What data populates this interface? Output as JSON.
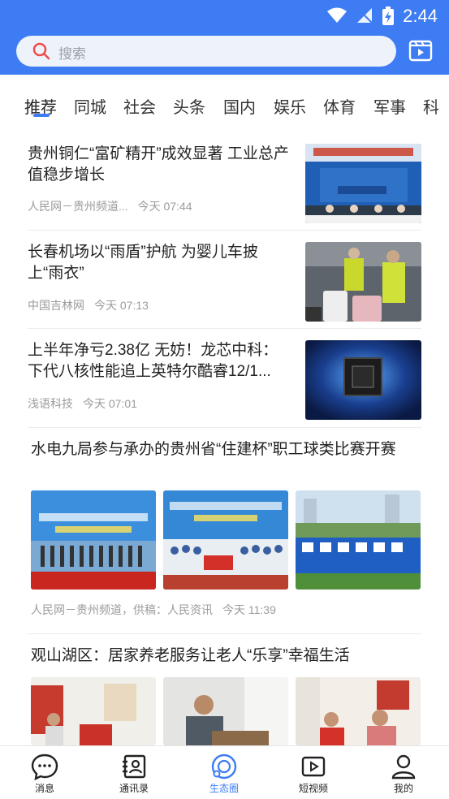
{
  "status_bar": {
    "time": "2:44"
  },
  "search": {
    "placeholder": "搜索"
  },
  "tabs": [
    {
      "label": "推荐"
    },
    {
      "label": "同城"
    },
    {
      "label": "社会"
    },
    {
      "label": "头条"
    },
    {
      "label": "国内"
    },
    {
      "label": "娱乐"
    },
    {
      "label": "体育"
    },
    {
      "label": "军事"
    },
    {
      "label": "科"
    }
  ],
  "articles": [
    {
      "title": "贵州铜仁“富矿精开”成效显著 工业总产值稳步增长",
      "source": "人民网－贵州频道...",
      "time": "今天 07:44"
    },
    {
      "title": "长春机场以“雨盾”护航 为婴儿车披上“雨衣”",
      "source": "中国吉林网",
      "time": "今天 07:13"
    },
    {
      "title": "上半年净亏2.38亿 无妨！龙芯中科：下代八核性能追上英特尔酷睿12/1...",
      "source": "浅语科技",
      "time": "今天 07:01"
    }
  ],
  "feature1": {
    "title": "水电九局参与承办的贵州省“住建杯”职工球类比赛开赛",
    "source": "人民网－贵州频道，供稿：人民资讯",
    "time": "今天 11:39"
  },
  "feature2": {
    "title": "观山湖区：居家养老服务让老人“乐享”幸福生活"
  },
  "nav": [
    {
      "label": "消息",
      "icon": "chat-icon"
    },
    {
      "label": "通讯录",
      "icon": "contacts-icon"
    },
    {
      "label": "生态圈",
      "icon": "ecosystem-icon"
    },
    {
      "label": "短视频",
      "icon": "video-icon"
    },
    {
      "label": "我的",
      "icon": "profile-icon"
    }
  ],
  "colors": {
    "brand": "#3d7cf3",
    "text": "#222222",
    "meta": "#9b9b9b"
  }
}
